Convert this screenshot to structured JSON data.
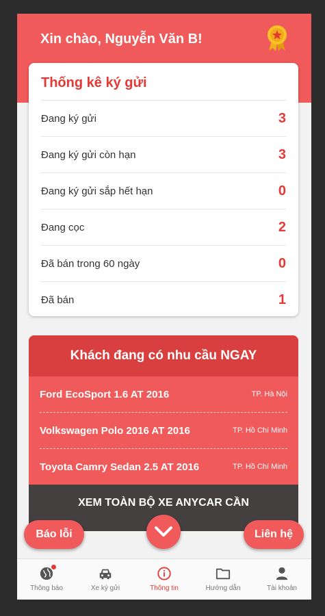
{
  "header": {
    "greeting": "Xin chào, Nguyễn Văn B!",
    "badge_icon": "medal-icon"
  },
  "stats": {
    "title": "Thống kê ký gửi",
    "rows": [
      {
        "label": "Đang ký gửi",
        "value": "3"
      },
      {
        "label": "Đang ký gửi còn hạn",
        "value": "3"
      },
      {
        "label": "Đang ký gửi sắp hết hạn",
        "value": "0"
      },
      {
        "label": "Đang cọc",
        "value": "2"
      },
      {
        "label": "Đã bán trong 60 ngày",
        "value": "0"
      },
      {
        "label": "Đã bán",
        "value": "1"
      }
    ]
  },
  "demand": {
    "title": "Khách đang có nhu cầu NGAY",
    "rows": [
      {
        "car": "Ford EcoSport 1.6 AT 2016",
        "city": "TP. Hà Nội"
      },
      {
        "car": "Volkswagen Polo 2016 AT 2016",
        "city": "TP. Hồ Chí Minh"
      },
      {
        "car": "Toyota Camry Sedan 2.5 AT 2016",
        "city": "TP. Hồ Chí Minh"
      }
    ],
    "see_all": "XEM TOÀN BỘ XE ANYCAR CẦN"
  },
  "actions": {
    "report": "Báo lỗi",
    "contact": "Liên hệ"
  },
  "nav": {
    "items": [
      {
        "label": "Thông báo",
        "icon": "globe-icon"
      },
      {
        "label": "Xe ký gửi",
        "icon": "car-icon"
      },
      {
        "label": "Thông tin",
        "icon": "info-icon"
      },
      {
        "label": "Hướng dẫn",
        "icon": "folder-icon"
      },
      {
        "label": "Tài khoản",
        "icon": "user-icon"
      }
    ],
    "active_index": 2
  },
  "colors": {
    "primary": "#f05a5a",
    "accent_text": "#e53935",
    "dark_bar": "#454040"
  }
}
